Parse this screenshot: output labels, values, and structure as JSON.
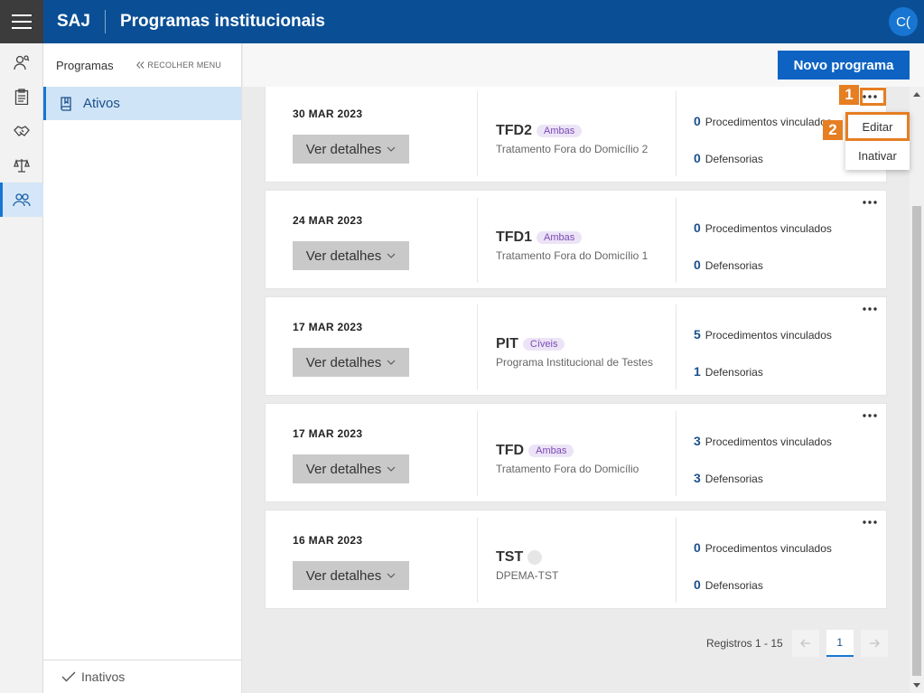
{
  "header": {
    "brand": "SAJ",
    "title": "Programas institucionais",
    "avatar_initials": "C("
  },
  "rail": {
    "items": [
      {
        "icon": "person-search-icon"
      },
      {
        "icon": "clipboard-icon"
      },
      {
        "icon": "handshake-icon"
      },
      {
        "icon": "scale-icon"
      },
      {
        "icon": "group-icon",
        "active": true
      }
    ]
  },
  "sidebar": {
    "title": "Programas",
    "collapse_label": "RECOLHER MENU",
    "active_item": "Ativos",
    "footer_item": "Inativos"
  },
  "toolbar": {
    "new_button": "Novo programa"
  },
  "cards": [
    {
      "date": "30 MAR 2023",
      "details": "Ver detalhes",
      "code": "TFD2",
      "badge": "Ambas",
      "desc": "Tratamento Fora do Domicílio 2",
      "proc_count": "0",
      "proc_label": "Procedimentos vinculados",
      "def_count": "0",
      "def_label": "Defensorias"
    },
    {
      "date": "24 MAR 2023",
      "details": "Ver detalhes",
      "code": "TFD1",
      "badge": "Ambas",
      "desc": "Tratamento Fora do Domicílio 1",
      "proc_count": "0",
      "proc_label": "Procedimentos vinculados",
      "def_count": "0",
      "def_label": "Defensorias"
    },
    {
      "date": "17 MAR 2023",
      "details": "Ver detalhes",
      "code": "PIT",
      "badge": "Cíveis",
      "desc": "Programa Institucional de Testes",
      "proc_count": "5",
      "proc_label": "Procedimentos vinculados",
      "def_count": "1",
      "def_label": "Defensorias"
    },
    {
      "date": "17 MAR 2023",
      "details": "Ver detalhes",
      "code": "TFD",
      "badge": "Ambas",
      "desc": "Tratamento Fora do Domicílio",
      "proc_count": "3",
      "proc_label": "Procedimentos vinculados",
      "def_count": "3",
      "def_label": "Defensorias"
    },
    {
      "date": "16 MAR 2023",
      "details": "Ver detalhes",
      "code": "TST",
      "badge": "",
      "desc": "DPEMA-TST",
      "proc_count": "0",
      "proc_label": "Procedimentos vinculados",
      "def_count": "0",
      "def_label": "Defensorias"
    }
  ],
  "popup_menu": {
    "edit": "Editar",
    "deactivate": "Inativar"
  },
  "callouts": {
    "one": "1",
    "two": "2"
  },
  "pagination": {
    "label": "Registros 1 - 15",
    "current_page": "1"
  },
  "colors": {
    "header_bg": "#0a4f95",
    "accent": "#0e63c2",
    "callout": "#e67e22"
  }
}
